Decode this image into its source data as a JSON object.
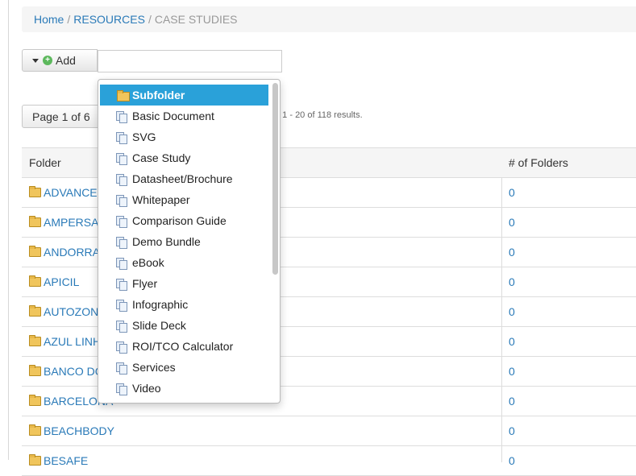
{
  "breadcrumb": {
    "home": "Home",
    "resources": "RESOURCES",
    "current": "CASE STUDIES",
    "sep": "/"
  },
  "toolbar": {
    "add_label": "Add",
    "add_input_value": ""
  },
  "pagination": {
    "page_label": "Page 1 of 6",
    "results_text": "g 1 - 20 of 118 results."
  },
  "table": {
    "headers": {
      "folder": "Folder",
      "count": "# of Folders"
    },
    "rows": [
      {
        "folder": "ADVANCED",
        "count": "0"
      },
      {
        "folder": "AMPERSAN",
        "count": "0"
      },
      {
        "folder": "ANDORRA",
        "count": "0"
      },
      {
        "folder": "APICIL",
        "count": "0"
      },
      {
        "folder": "AUTOZONE",
        "count": "0"
      },
      {
        "folder": "AZUL LINH",
        "count": "0"
      },
      {
        "folder": "BANCO DO",
        "count": "0"
      },
      {
        "folder": "BARCELONA",
        "count": "0"
      },
      {
        "folder": "BEACHBODY",
        "count": "0"
      },
      {
        "folder": "BESAFE",
        "count": "0"
      }
    ]
  },
  "dropdown": {
    "items": [
      {
        "label": "Subfolder",
        "icon": "folder-icon",
        "selected": true
      },
      {
        "label": "Basic Document",
        "icon": "document-icon"
      },
      {
        "label": "SVG",
        "icon": "document-icon"
      },
      {
        "label": "Case Study",
        "icon": "document-icon"
      },
      {
        "label": "Datasheet/Brochure",
        "icon": "document-icon"
      },
      {
        "label": "Whitepaper",
        "icon": "document-icon"
      },
      {
        "label": "Comparison Guide",
        "icon": "document-icon"
      },
      {
        "label": "Demo Bundle",
        "icon": "document-icon"
      },
      {
        "label": "eBook",
        "icon": "document-icon"
      },
      {
        "label": "Flyer",
        "icon": "document-icon"
      },
      {
        "label": "Infographic",
        "icon": "document-icon"
      },
      {
        "label": "Slide Deck",
        "icon": "document-icon"
      },
      {
        "label": "ROI/TCO Calculator",
        "icon": "document-icon"
      },
      {
        "label": "Services",
        "icon": "document-icon"
      },
      {
        "label": "Video",
        "icon": "document-icon"
      }
    ]
  },
  "colors": {
    "link": "#2a7ab8",
    "selected": "#2aa1d9"
  }
}
